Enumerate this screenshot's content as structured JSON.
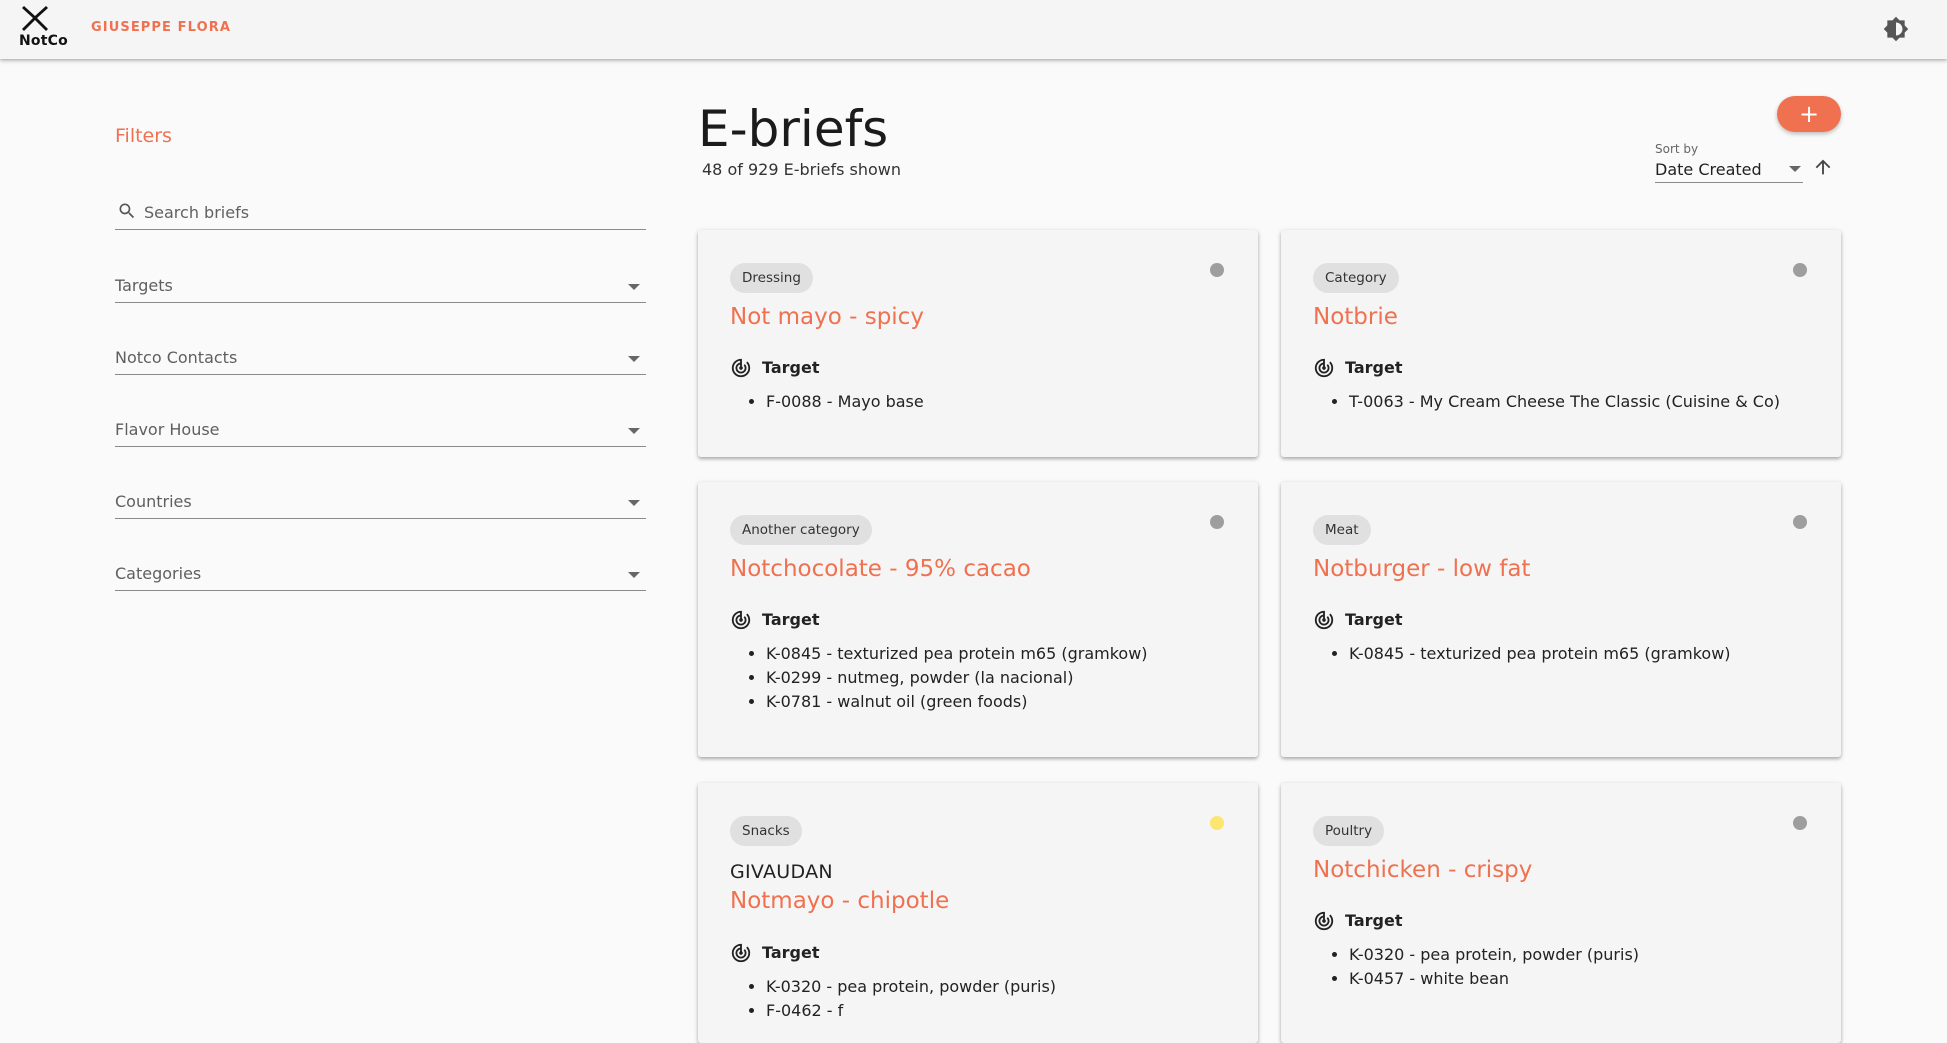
{
  "header": {
    "logo_text": "NotCo",
    "user_name": "GIUSEPPE FLORA",
    "theme_icon": "brightness-icon"
  },
  "filters": {
    "title": "Filters",
    "search_placeholder": "Search briefs",
    "selects": [
      "Targets",
      "Notco Contacts",
      "Flavor House",
      "Countries",
      "Categories"
    ]
  },
  "main": {
    "title": "E-briefs",
    "count_text": "48 of 929 E-briefs shown",
    "add_label": "+",
    "sort_caption": "Sort by",
    "sort_value": "Date Created",
    "sort_direction_icon": "arrow-up-icon"
  },
  "colors": {
    "accent": "#ef7150",
    "status_grey": "#9e9e9e",
    "status_yellow": "#fce570"
  },
  "target_label": "Target",
  "cards": [
    {
      "category": "Dressing",
      "status": "grey",
      "flavor_house": "",
      "title": "Not mayo - spicy",
      "targets": [
        "F-0088 - Mayo base"
      ]
    },
    {
      "category": "Category",
      "status": "grey",
      "flavor_house": "",
      "title": "Notbrie",
      "targets": [
        "T-0063 - My Cream Cheese The Classic (Cuisine & Co)"
      ]
    },
    {
      "category": "Another category",
      "status": "grey",
      "flavor_house": "",
      "title": "Notchocolate - 95% cacao",
      "targets": [
        "K-0845 - texturized pea protein m65 (gramkow)",
        "K-0299 - nutmeg, powder (la nacional)",
        "K-0781 - walnut oil (green foods)"
      ]
    },
    {
      "category": "Meat",
      "status": "grey",
      "flavor_house": "",
      "title": "Notburger - low fat",
      "targets": [
        "K-0845 - texturized pea protein m65 (gramkow)"
      ]
    },
    {
      "category": "Snacks",
      "status": "yellow",
      "flavor_house": "GIVAUDAN",
      "title": "Notmayo - chipotle",
      "targets": [
        "K-0320 - pea protein, powder (puris)",
        "F-0462 - f"
      ]
    },
    {
      "category": "Poultry",
      "status": "grey",
      "flavor_house": "",
      "title": "Notchicken - crispy",
      "targets": [
        "K-0320 - pea protein, powder (puris)",
        "K-0457 - white bean"
      ]
    }
  ]
}
